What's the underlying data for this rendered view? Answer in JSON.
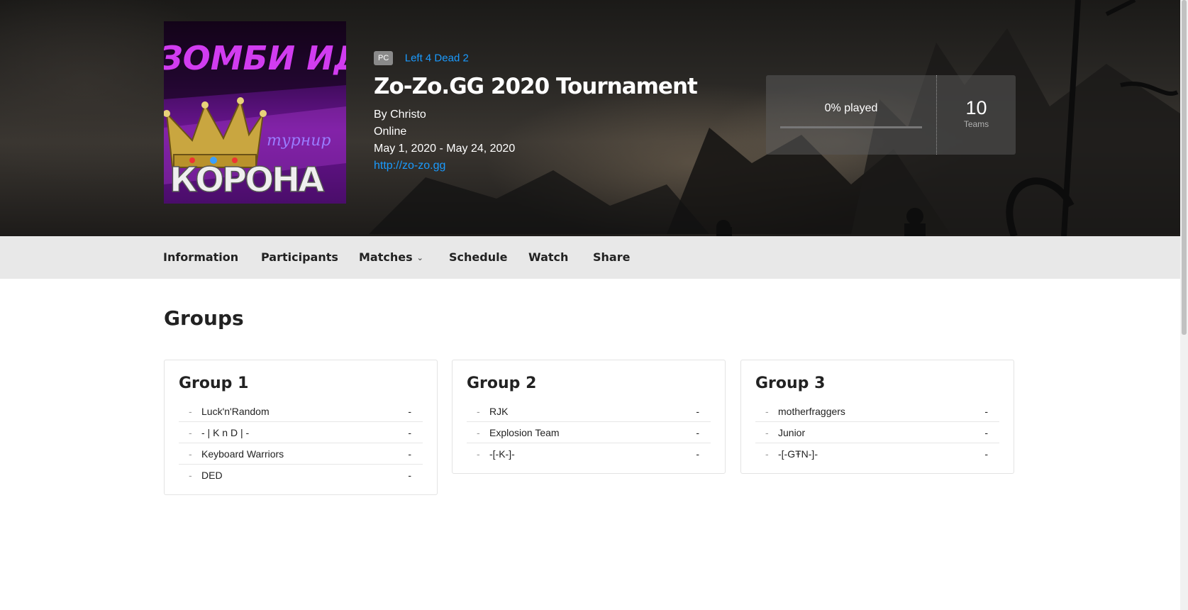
{
  "hero": {
    "cover_top_text": "ЗОМБИ ИДУ",
    "cover_script_text": "турнир",
    "cover_main_text": "КОРОНА",
    "platform": "PC",
    "game": "Left 4 Dead 2",
    "title": "Zo-Zo.GG 2020 Tournament",
    "organizer": "By Christo",
    "location": "Online",
    "dates": "May 1, 2020 - May 24, 2020",
    "website": "http://zo-zo.gg",
    "played_label": "0% played",
    "played_fraction": 0,
    "teams_count": "10",
    "teams_label": "Teams"
  },
  "nav": {
    "items": [
      "Information",
      "Participants",
      "Matches",
      "Schedule",
      "Watch",
      "Share"
    ]
  },
  "section_title": "Groups",
  "groups": [
    {
      "name": "Group 1",
      "teams": [
        {
          "name": "Luck'n'Random",
          "score": "-"
        },
        {
          "name": "- | K n D | -",
          "score": "-"
        },
        {
          "name": "Keyboard Warriors",
          "score": "-"
        },
        {
          "name": "DED",
          "score": "-"
        }
      ]
    },
    {
      "name": "Group 2",
      "teams": [
        {
          "name": "RJK",
          "score": "-"
        },
        {
          "name": "Explosion Team",
          "score": "-"
        },
        {
          "name": "-[-K-]-",
          "score": "-"
        }
      ]
    },
    {
      "name": "Group 3",
      "teams": [
        {
          "name": "motherfraggers",
          "score": "-"
        },
        {
          "name": "Junior",
          "score": "-"
        },
        {
          "name": "-[-GŦN-]-",
          "score": "-"
        }
      ]
    }
  ],
  "row_marker": "-",
  "colors": {
    "link": "#1a9bff",
    "nav_bg": "#e8e8e8",
    "cover_purple": "#6a1590"
  },
  "icons": {
    "matches_dropdown": "chevron-down-icon",
    "cover_crown": "crown-icon"
  }
}
